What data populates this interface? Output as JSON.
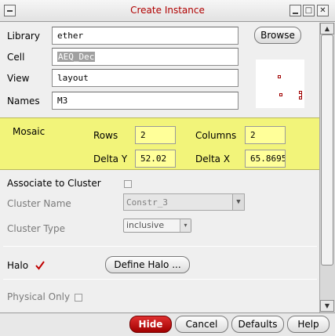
{
  "window": {
    "title": "Create Instance",
    "controls": [
      "□",
      "✕"
    ]
  },
  "form": {
    "library_label": "Library",
    "library_value": "ether",
    "browse_label": "Browse",
    "cell_label": "Cell",
    "cell_value": "AEQ_Dec",
    "view_label": "View",
    "view_value": "layout",
    "names_label": "Names",
    "names_value": "M3"
  },
  "mosaic": {
    "title": "Mosaic",
    "rows_label": "Rows",
    "rows_value": "2",
    "columns_label": "Columns",
    "columns_value": "2",
    "delta_y_label": "Delta Y",
    "delta_y_value": "52.02",
    "delta_x_label": "Delta X",
    "delta_x_value": "65.8695"
  },
  "cluster": {
    "associate_label": "Associate to Cluster",
    "associate_checked": false,
    "name_label": "Cluster Name",
    "name_value": "Constr_3",
    "type_label": "Cluster Type",
    "type_value": "inclusive"
  },
  "halo": {
    "label": "Halo",
    "checked": true,
    "define_label": "Define Halo ..."
  },
  "physical_only": {
    "label": "Physical Only",
    "checked": false
  },
  "footer": {
    "hide_label": "Hide",
    "cancel_label": "Cancel",
    "defaults_label": "Defaults",
    "help_label": "Help"
  },
  "colors": {
    "title_text": "#b00000",
    "mosaic_bg": "#f2f47a",
    "input_highlight": "#ffff99",
    "check_red": "#c00000",
    "hide_button": "#c01010"
  }
}
